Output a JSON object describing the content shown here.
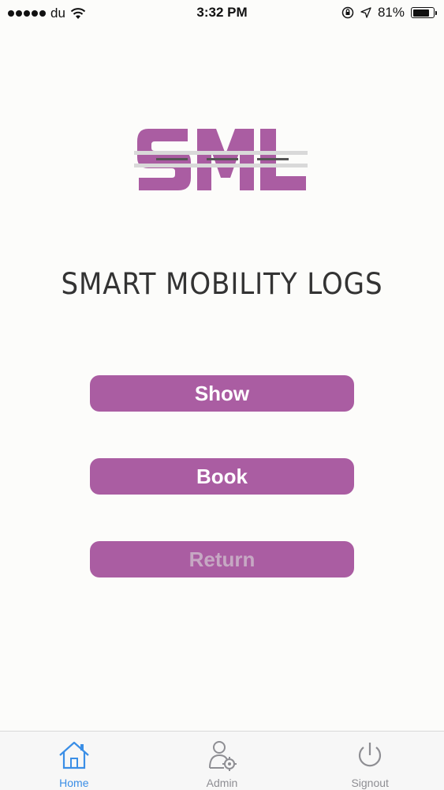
{
  "status_bar": {
    "carrier": "du",
    "time": "3:32 PM",
    "battery": "81%",
    "battery_level": 0.81
  },
  "logo": {
    "text": "SML",
    "color": "#aa5da2"
  },
  "title": "SMART MOBILITY LOGS",
  "buttons": {
    "show": "Show",
    "book": "Book",
    "return": "Return"
  },
  "colors": {
    "accent": "#aa5da2",
    "tab_active": "#3a8ee6",
    "tab_inactive": "#8e8e93",
    "disabled_text": "#c6a8c3"
  },
  "tabs": [
    {
      "label": "Home",
      "icon": "home-icon",
      "active": true
    },
    {
      "label": "Admin",
      "icon": "admin-icon",
      "active": false
    },
    {
      "label": "Signout",
      "icon": "signout-icon",
      "active": false
    }
  ]
}
